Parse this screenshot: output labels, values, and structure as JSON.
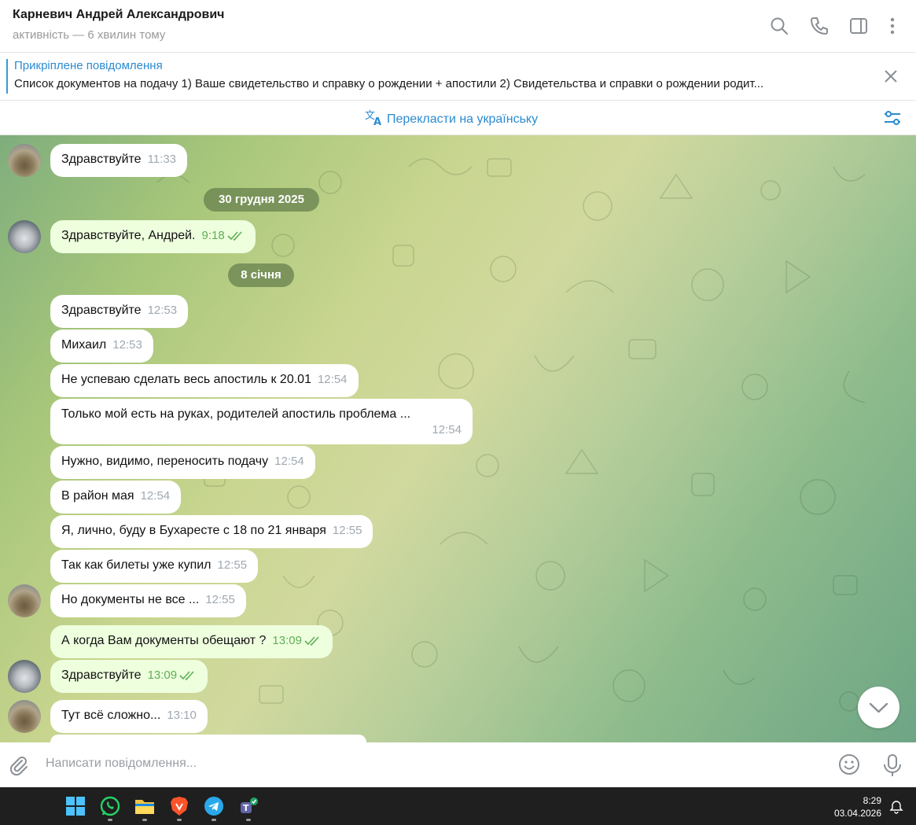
{
  "header": {
    "contact_name": "Карневич Андрей Александрович",
    "status": "активність — 6 хвилин тому"
  },
  "pinned": {
    "title": "Прикріплене повідомлення",
    "text": "Список документов на подачу  1) Ваше свидетельство и справку о рождении + апостили 2) Свидетельства и справки о рождении родит..."
  },
  "translate": {
    "label": "Перекласти на українську"
  },
  "messages": [
    {
      "text": "Здравствуйте",
      "time": "11:33",
      "direction": "in"
    },
    {
      "text": "Здравствуйте, Андрей.",
      "time": "9:18",
      "direction": "out",
      "read": true
    },
    {
      "text": "Здравствуйте",
      "time": "12:53",
      "direction": "in"
    },
    {
      "text": "Михаил",
      "time": "12:53",
      "direction": "in"
    },
    {
      "text": "Не успеваю сделать весь апостиль к 20.01",
      "time": "12:54",
      "direction": "in"
    },
    {
      "text": "Только мой есть на руках, родителей апостиль проблема ...",
      "time": "12:54",
      "direction": "in"
    },
    {
      "text": "Нужно, видимо, переносить подачу",
      "time": "12:54",
      "direction": "in"
    },
    {
      "text": "В район мая",
      "time": "12:54",
      "direction": "in"
    },
    {
      "text": "Я, лично, буду в Бухаресте с 18 по 21 января",
      "time": "12:55",
      "direction": "in"
    },
    {
      "text": "Так как билеты уже купил",
      "time": "12:55",
      "direction": "in"
    },
    {
      "text": "Но документы не все ...",
      "time": "12:55",
      "direction": "in"
    },
    {
      "text": "А когда Вам документы обещают ?",
      "time": "13:09",
      "direction": "out",
      "read": true
    },
    {
      "text": "Здравствуйте",
      "time": "13:09",
      "direction": "out",
      "read": true
    },
    {
      "text": "Тут всё сложно...",
      "time": "13:10",
      "direction": "in"
    }
  ],
  "date_separators": [
    "30 грудня 2025",
    "8 січня"
  ],
  "composer": {
    "placeholder": "Написати повідомлення..."
  },
  "taskbar": {
    "time": "8:29",
    "date": "03.04.2026",
    "apps": [
      "windows-start",
      "whatsapp",
      "file-explorer",
      "brave",
      "telegram",
      "teams"
    ]
  },
  "colors": {
    "accent": "#2b8bd0",
    "outgoing_bubble": "#eeffde",
    "read_tick": "#5fae57"
  }
}
